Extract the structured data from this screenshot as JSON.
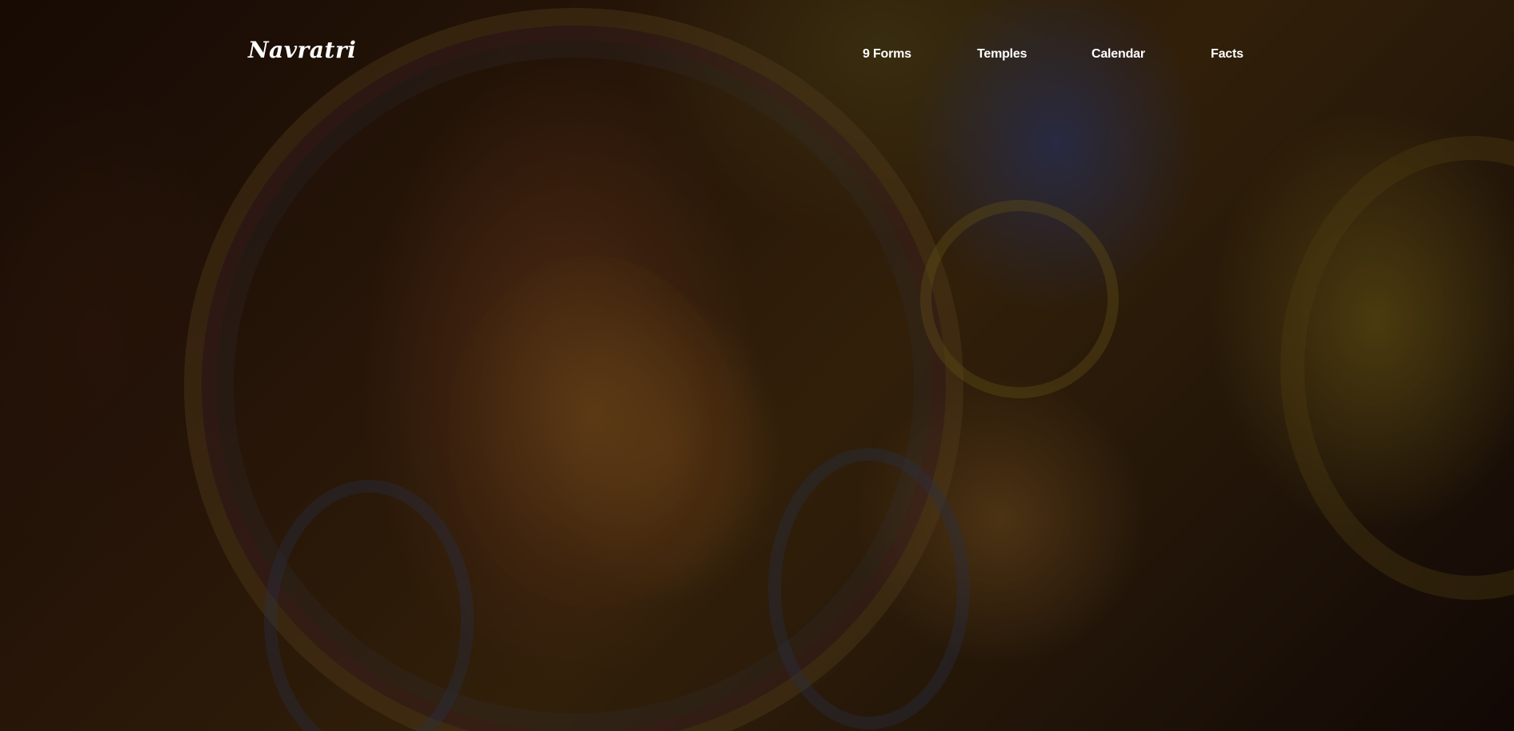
{
  "brand": {
    "name": "Navratri"
  },
  "nav": {
    "items": [
      {
        "label": "9 Forms"
      },
      {
        "label": "Temples"
      },
      {
        "label": "Calendar"
      },
      {
        "label": "Facts"
      }
    ]
  },
  "hero": {
    "image": "durga-idol-image",
    "overlay": "dark"
  }
}
